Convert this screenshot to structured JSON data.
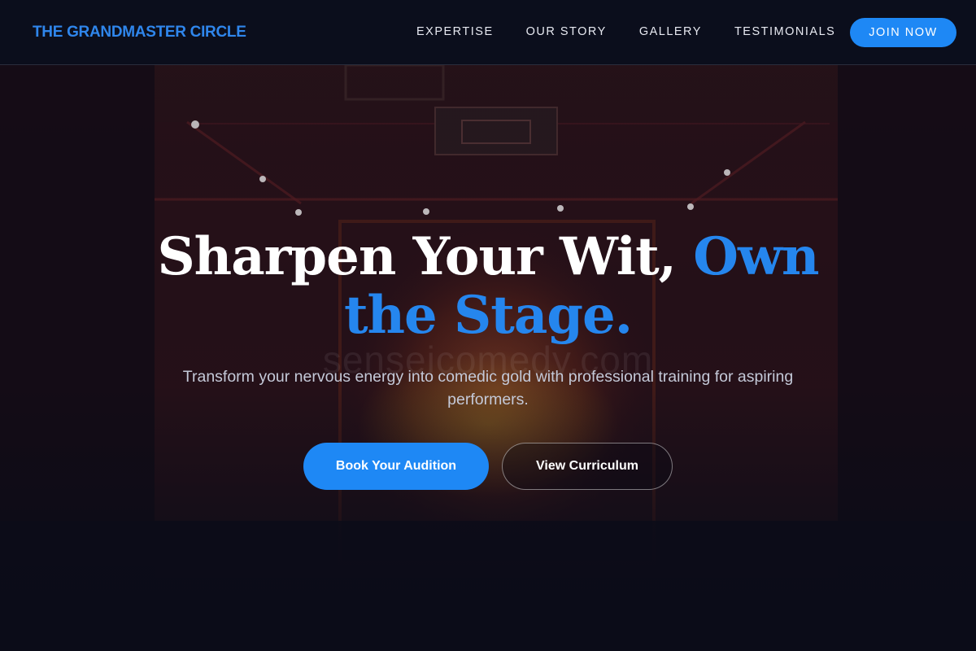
{
  "brand": {
    "name": "THE GRANDMASTER CIRCLE"
  },
  "nav": {
    "links": [
      {
        "label": "EXPERTISE"
      },
      {
        "label": "OUR STORY"
      },
      {
        "label": "GALLERY"
      },
      {
        "label": "TESTIMONIALS"
      }
    ],
    "cta_label": "JOIN NOW"
  },
  "hero": {
    "title_part1": "Sharpen Your Wit, ",
    "title_accent": "Own the Stage.",
    "subtitle": "Transform your nervous energy into comedic gold with professional training for aspiring performers.",
    "primary_button": "Book Your Audition",
    "secondary_button": "View Curriculum",
    "background_watermark": "senseicomedy.com"
  },
  "colors": {
    "accent": "#1e88f5",
    "brand_text": "#2f86ec",
    "nav_background": "#0b0e1c",
    "page_background": "#0b0c18"
  },
  "background_image": "dimly lit stage with red walls and ceiling track lights"
}
